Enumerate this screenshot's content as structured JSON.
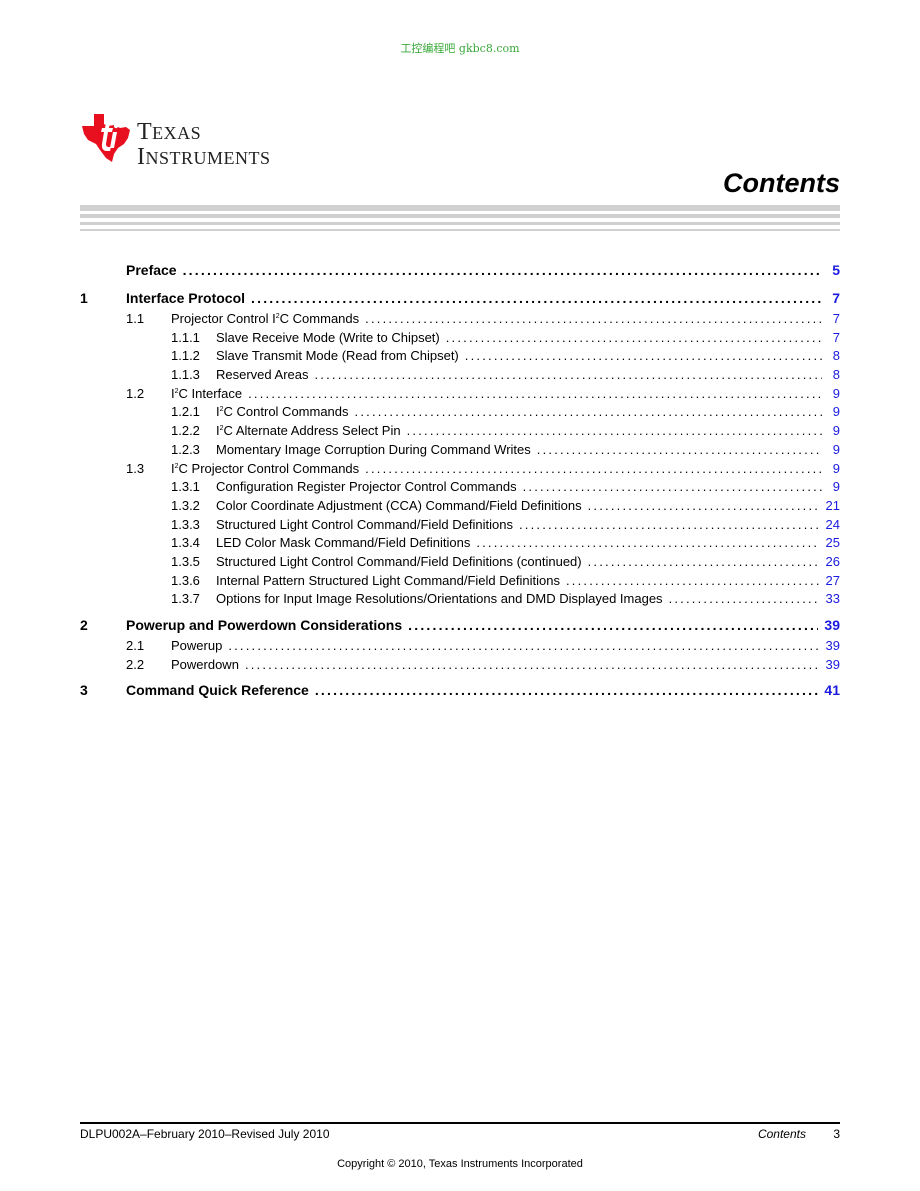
{
  "watermark": "工控编程吧 gkbc8.com",
  "logo": {
    "line1_first": "T",
    "line1_rest": "EXAS",
    "line2_first": "I",
    "line2_rest": "NSTRUMENTS"
  },
  "title": "Contents",
  "toc": [
    {
      "level": 0,
      "num": "",
      "label": "Preface",
      "page": "5"
    },
    {
      "level": 0,
      "num": "1",
      "label": "Interface Protocol",
      "page": "7"
    },
    {
      "level": 1,
      "num": "1.1",
      "label_pre": "Projector Control I",
      "sup": "2",
      "label_post": "C Commands",
      "page": "7"
    },
    {
      "level": 2,
      "num": "1.1.1",
      "label": "Slave Receive Mode (Write to Chipset)",
      "page": "7"
    },
    {
      "level": 2,
      "num": "1.1.2",
      "label": "Slave Transmit Mode (Read from Chipset)",
      "page": "8"
    },
    {
      "level": 2,
      "num": "1.1.3",
      "label": "Reserved Areas",
      "page": "8"
    },
    {
      "level": 1,
      "num": "1.2",
      "label_pre": "I",
      "sup": "2",
      "label_post": "C Interface",
      "page": "9"
    },
    {
      "level": 2,
      "num": "1.2.1",
      "label_pre": "I",
      "sup": "2",
      "label_post": "C Control Commands",
      "page": "9"
    },
    {
      "level": 2,
      "num": "1.2.2",
      "label_pre": "I",
      "sup": "2",
      "label_post": "C Alternate Address Select Pin",
      "page": "9"
    },
    {
      "level": 2,
      "num": "1.2.3",
      "label": "Momentary Image Corruption During Command Writes",
      "page": "9"
    },
    {
      "level": 1,
      "num": "1.3",
      "label_pre": "I",
      "sup": "2",
      "label_post": "C Projector Control Commands",
      "page": "9"
    },
    {
      "level": 2,
      "num": "1.3.1",
      "label": "Configuration Register Projector Control Commands",
      "page": "9"
    },
    {
      "level": 2,
      "num": "1.3.2",
      "label": "Color Coordinate Adjustment (CCA) Command/Field Definitions",
      "page": "21"
    },
    {
      "level": 2,
      "num": "1.3.3",
      "label": "Structured Light Control Command/Field Definitions",
      "page": "24"
    },
    {
      "level": 2,
      "num": "1.3.4",
      "label": "LED Color Mask Command/Field Definitions",
      "page": "25"
    },
    {
      "level": 2,
      "num": "1.3.5",
      "label": "Structured Light Control Command/Field Definitions (continued)",
      "page": "26"
    },
    {
      "level": 2,
      "num": "1.3.6",
      "label": "Internal Pattern Structured Light Command/Field Definitions",
      "page": "27"
    },
    {
      "level": 2,
      "num": "1.3.7",
      "label": "Options for Input Image Resolutions/Orientations and DMD Displayed Images",
      "page": "33"
    },
    {
      "level": 0,
      "num": "2",
      "label": "Powerup and Powerdown Considerations",
      "page": "39"
    },
    {
      "level": 1,
      "num": "2.1",
      "label": "Powerup",
      "page": "39"
    },
    {
      "level": 1,
      "num": "2.2",
      "label": "Powerdown",
      "page": "39"
    },
    {
      "level": 0,
      "num": "3",
      "label": "Command Quick Reference",
      "page": "41"
    }
  ],
  "footer": {
    "doc_id": "DLPU002A–February 2010–Revised July 2010",
    "section": "Contents",
    "page_number": "3"
  },
  "copyright": "Copyright © 2010, Texas Instruments Incorporated",
  "colors": {
    "link": "#1a1ae0",
    "logo_red": "#e8101e",
    "watermark": "#3aa83a"
  }
}
